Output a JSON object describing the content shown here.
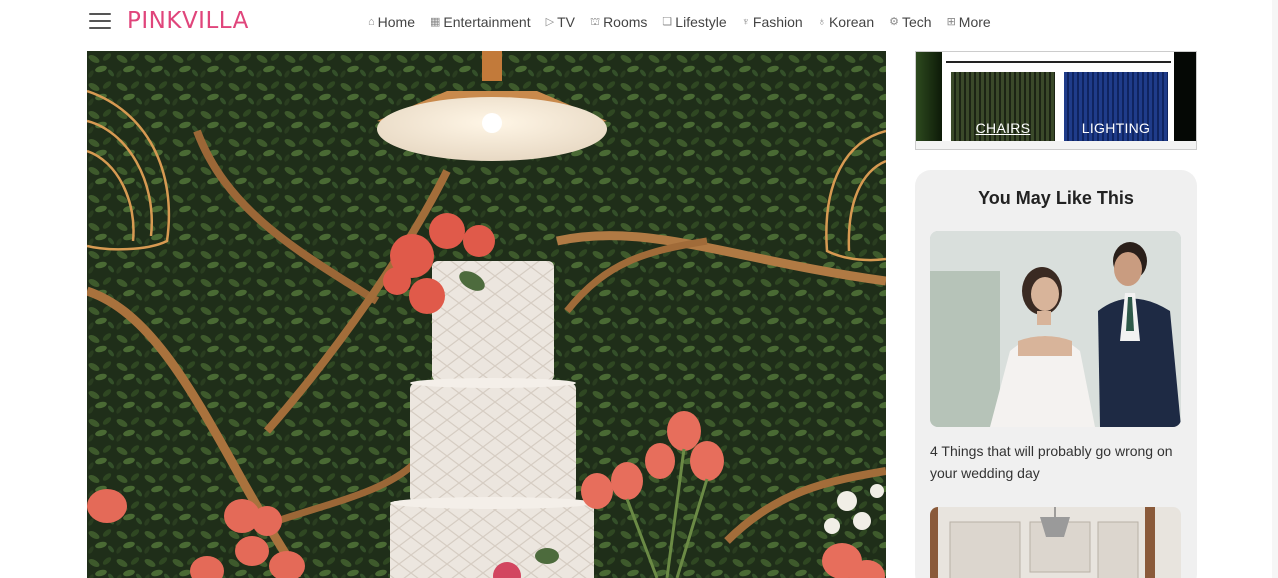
{
  "header": {
    "logo": "PINKVILLA",
    "nav": [
      {
        "label": "Home",
        "icon": "home-icon",
        "glyph": "⌂"
      },
      {
        "label": "Entertainment",
        "icon": "film-icon",
        "glyph": "▦"
      },
      {
        "label": "TV",
        "icon": "tv-icon",
        "glyph": "▷"
      },
      {
        "label": "Rooms",
        "icon": "rooms-icon",
        "glyph": "⛫"
      },
      {
        "label": "Lifestyle",
        "icon": "lifestyle-icon",
        "glyph": "❏"
      },
      {
        "label": "Fashion",
        "icon": "fashion-icon",
        "glyph": "♆"
      },
      {
        "label": "Korean",
        "icon": "korean-icon",
        "glyph": "♁"
      },
      {
        "label": "Tech",
        "icon": "tech-icon",
        "glyph": "⚙"
      },
      {
        "label": "More",
        "icon": "grid-icon",
        "glyph": "⊞"
      }
    ]
  },
  "ad": {
    "panels": [
      "CHAIRS",
      "LIGHTING"
    ]
  },
  "sidebar": {
    "title": "You May Like This",
    "articles": [
      {
        "caption": "4 Things that will probably go wrong on your wedding day"
      }
    ]
  },
  "colors": {
    "brand": "#e0457b"
  }
}
